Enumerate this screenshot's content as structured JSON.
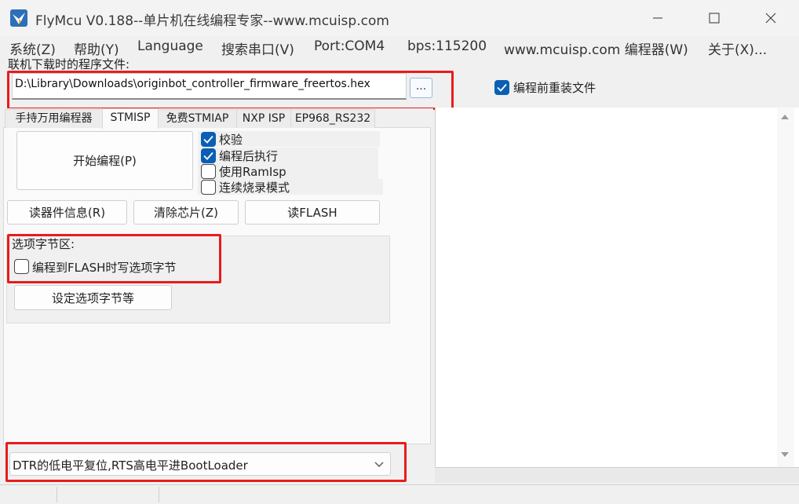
{
  "window": {
    "title": "FlyMcu V0.188--单片机在线编程专家--www.mcuisp.com"
  },
  "menu": [
    {
      "id": "system",
      "label": "系统(Z)"
    },
    {
      "id": "help",
      "label": "帮助(Y)"
    },
    {
      "id": "language",
      "label": "Language"
    },
    {
      "id": "search-port",
      "label": "搜索串口(V)"
    },
    {
      "id": "port",
      "label": "Port:COM4"
    },
    {
      "id": "bps",
      "label": "bps:115200"
    },
    {
      "id": "programmer",
      "label": "www.mcuisp.com 编程器(W)"
    },
    {
      "id": "about",
      "label": "关于(X)..."
    }
  ],
  "file": {
    "label": "联机下载时的程序文件:",
    "path": "D:\\Library\\Downloads\\originbot_controller_firmware_freertos.hex",
    "browse_label": "...",
    "reload_label": "编程前重装文件",
    "reload_checked": true
  },
  "tabs": [
    {
      "label": "手持万用编程器",
      "active": false
    },
    {
      "label": "STMISP",
      "active": true
    },
    {
      "label": "免费STMIAP",
      "active": false
    },
    {
      "label": "NXP ISP",
      "active": false
    },
    {
      "label": "EP968_RS232",
      "active": false
    }
  ],
  "stmisp": {
    "start_label": "开始编程(P)",
    "options": [
      {
        "label": "校验",
        "checked": true
      },
      {
        "label": "编程后执行",
        "checked": true
      },
      {
        "label": "使用RamIsp",
        "checked": false
      },
      {
        "label": "连续烧录模式",
        "checked": false
      }
    ],
    "read_info_label": "读器件信息(R)",
    "erase_label": "清除芯片(Z)",
    "read_flash_label": "读FLASH",
    "option_bytes": {
      "title": "选项字节区:",
      "write_label": "编程到FLASH时写选项字节",
      "write_checked": false,
      "set_label": "设定选项字节等"
    },
    "boot_mode": "DTR的低电平复位,RTS高电平进BootLoader"
  }
}
